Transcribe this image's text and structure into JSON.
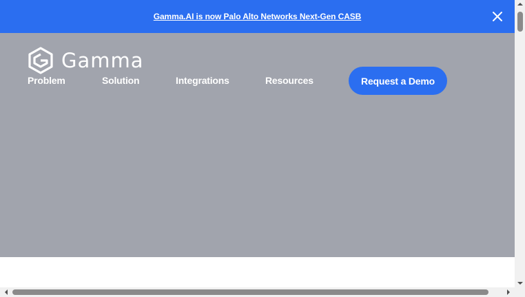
{
  "banner": {
    "link_text": "Gamma.AI is now Palo Alto Networks Next-Gen CASB",
    "close_icon": "close-icon",
    "background": "#2b6ef0"
  },
  "header": {
    "logo_text": "Gamma",
    "logo_icon": "gamma-hexagon-logo",
    "nav": [
      {
        "label": "Problem"
      },
      {
        "label": "Solution"
      },
      {
        "label": "Integrations"
      },
      {
        "label": "Resources"
      }
    ],
    "cta_label": "Request a Demo",
    "cta_color": "#2b6ef0"
  },
  "hero": {
    "background": "#a1a4ad"
  }
}
